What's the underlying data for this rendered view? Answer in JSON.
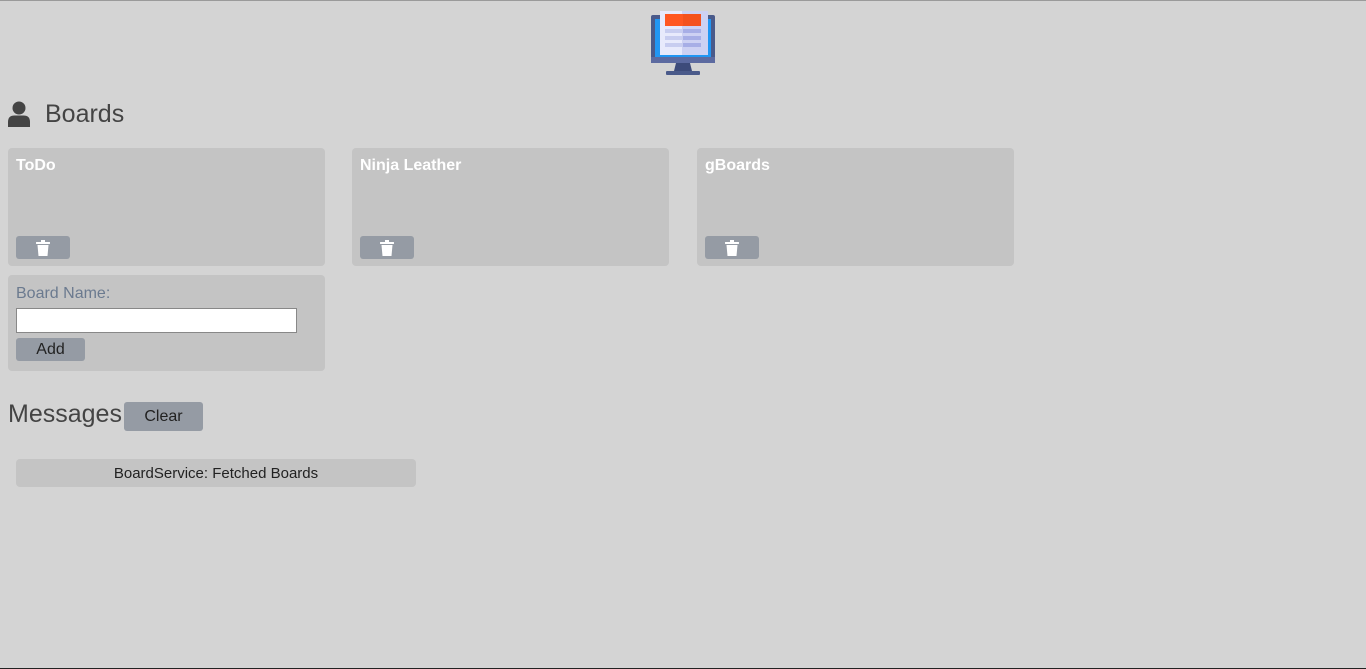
{
  "logo": {
    "icon": "monitor-document-icon",
    "colors": {
      "monitor": "#4a5a8a",
      "screen": "#2196f3",
      "paper": "#e8eafc",
      "header": "#ff5722"
    }
  },
  "header": {
    "icon": "user-icon",
    "title": "Boards"
  },
  "boards": [
    {
      "name": "ToDo",
      "delete_icon": "trash-icon"
    },
    {
      "name": "Ninja Leather",
      "delete_icon": "trash-icon"
    },
    {
      "name": "gBoards",
      "delete_icon": "trash-icon"
    }
  ],
  "add_board": {
    "label": "Board Name:",
    "value": "",
    "placeholder": "",
    "button_label": "Add"
  },
  "messages": {
    "title": "Messages",
    "clear_label": "Clear",
    "items": [
      "BoardService: Fetched Boards"
    ]
  },
  "colors": {
    "background": "#d4d4d4",
    "card": "#c4c4c4",
    "button": "#959ba4",
    "label": "#6b7a8f",
    "card_title": "#ffffff"
  }
}
